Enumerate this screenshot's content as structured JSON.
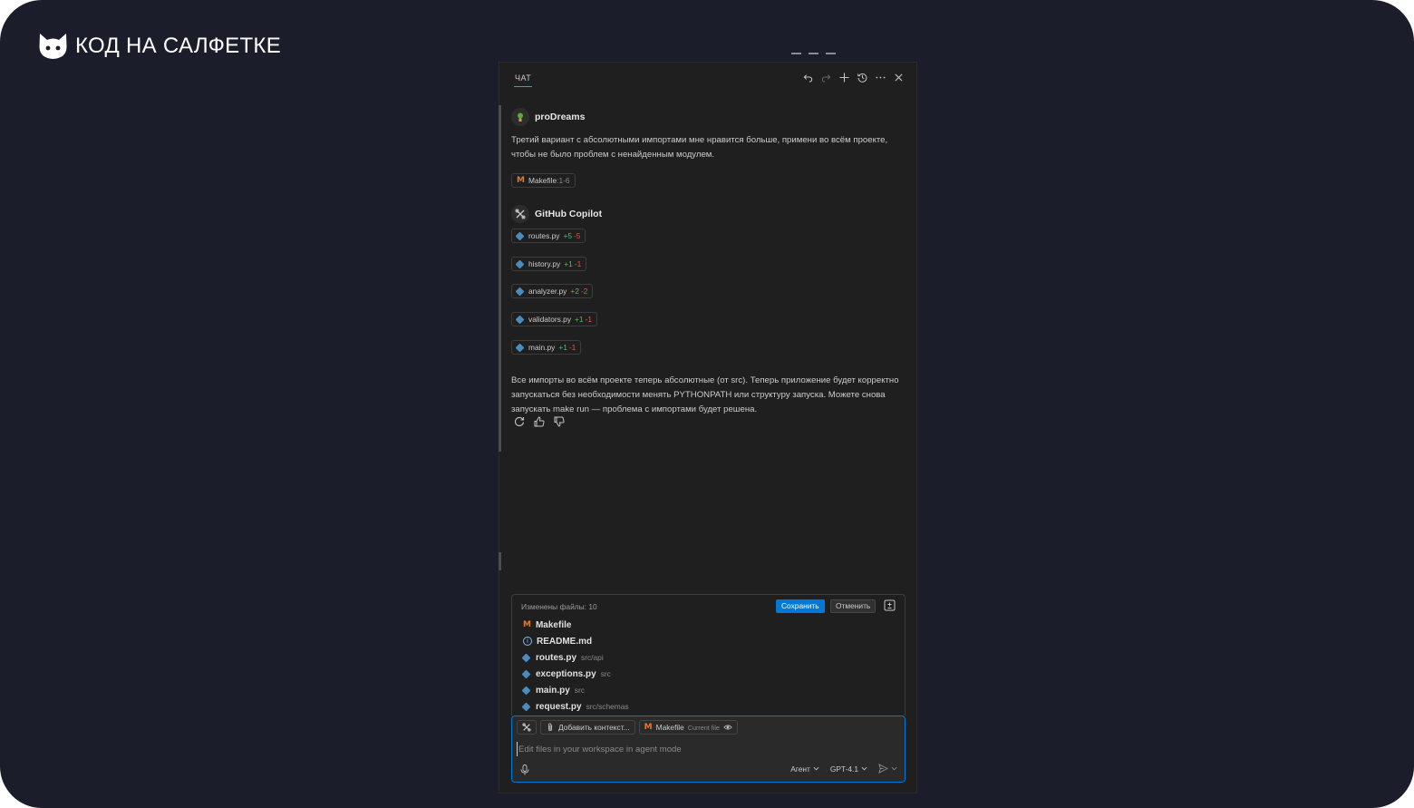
{
  "brand": {
    "name": "КОД НА САЛФЕТКЕ"
  },
  "header": {
    "tab_label": "ЧАТ"
  },
  "user_message": {
    "author": "proDreams",
    "text": "Третий вариант с абсолютными импортами мне нравится больше, примени во всём проекте, чтобы не было проблем с ненайденным модулем.",
    "reference": {
      "file": "Makefile",
      "range": ":1-6"
    }
  },
  "assistant_message": {
    "author": "GitHub Copilot",
    "edits": [
      {
        "file": "routes.py",
        "added": "+5",
        "removed": "-5"
      },
      {
        "file": "history.py",
        "added": "+1",
        "removed": "-1"
      },
      {
        "file": "analyzer.py",
        "added": "+2",
        "removed": "-2"
      },
      {
        "file": "validators.py",
        "added": "+1",
        "removed": "-1"
      },
      {
        "file": "main.py",
        "added": "+1",
        "removed": "-1"
      }
    ],
    "text": "Все импорты во всём проекте теперь абсолютные (от src). Теперь приложение будет корректно запускаться без необходимости менять PYTHONPATH или структуру запуска. Можете снова запускать make run — проблема с импортами будет решена."
  },
  "changes": {
    "title": "Изменены файлы: 10",
    "save_label": "Сохранить",
    "cancel_label": "Отменить",
    "files": [
      {
        "name": "Makefile",
        "path": "",
        "icon": "makefile-icon"
      },
      {
        "name": "README.md",
        "path": "",
        "icon": "info-icon"
      },
      {
        "name": "routes.py",
        "path": "src/api",
        "icon": "python-icon"
      },
      {
        "name": "exceptions.py",
        "path": "src",
        "icon": "python-icon"
      },
      {
        "name": "main.py",
        "path": "src",
        "icon": "python-icon"
      },
      {
        "name": "request.py",
        "path": "src/schemas",
        "icon": "python-icon"
      }
    ]
  },
  "input": {
    "add_context_label": "Добавить контекст...",
    "current_file_name": "Makefile",
    "current_file_tag": "Current file",
    "placeholder": "Edit files in your workspace in agent mode",
    "mode_label": "Агент",
    "model_label": "GPT-4.1"
  },
  "colors": {
    "accent": "#0078d4",
    "added": "#4ec06a",
    "removed": "#f14c4c",
    "makefile": "#e37933",
    "python": "#4b8bbe",
    "background": "#1b1d2b",
    "panel": "#1f1f1f"
  }
}
